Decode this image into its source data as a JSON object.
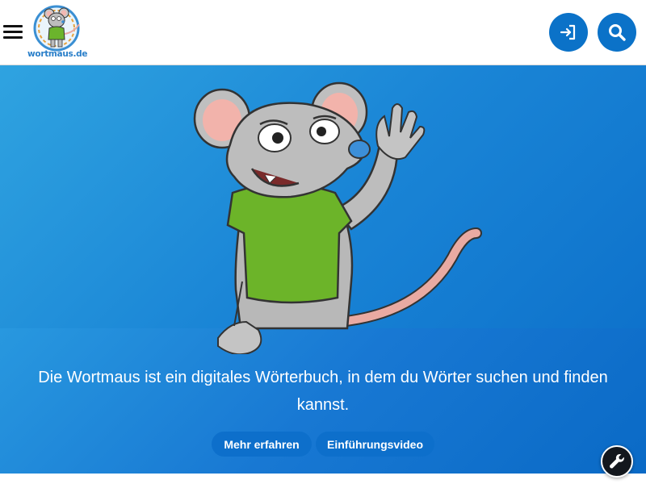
{
  "header": {
    "logo_text": "wortmaus.de",
    "icons": {
      "menu": "hamburger-menu-icon",
      "login": "login-icon",
      "search": "search-icon"
    },
    "accent_color": "#0b72c8"
  },
  "hero": {
    "tagline": "Die Wortmaus ist ein digitales Wörterbuch, in dem du Wörter suchen und finden kannst.",
    "buttons": {
      "more": "Mehr erfahren",
      "video": "Einführungsvideo"
    },
    "colors": {
      "top": "#2fa3e0",
      "bottom": "#0a6cc8"
    }
  },
  "tools": {
    "icon": "wrench-icon"
  }
}
